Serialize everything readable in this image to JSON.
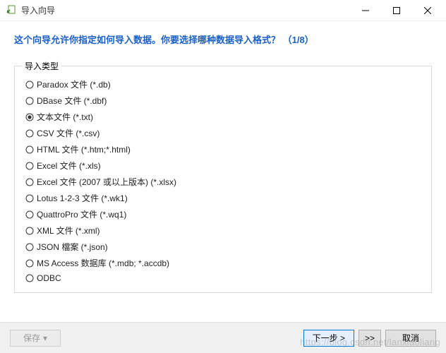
{
  "window": {
    "title": "导入向导"
  },
  "header": {
    "text": "这个向导允许你指定如何导入数据。你要选择哪种数据导入格式？ （1/8）"
  },
  "group": {
    "legend": "导入类型",
    "options": [
      {
        "label": "Paradox 文件 (*.db)",
        "selected": false
      },
      {
        "label": "DBase 文件 (*.dbf)",
        "selected": false
      },
      {
        "label": "文本文件 (*.txt)",
        "selected": true
      },
      {
        "label": "CSV 文件 (*.csv)",
        "selected": false
      },
      {
        "label": "HTML 文件 (*.htm;*.html)",
        "selected": false
      },
      {
        "label": "Excel 文件 (*.xls)",
        "selected": false
      },
      {
        "label": "Excel 文件 (2007 或以上版本) (*.xlsx)",
        "selected": false
      },
      {
        "label": "Lotus 1-2-3 文件 (*.wk1)",
        "selected": false
      },
      {
        "label": "QuattroPro 文件 (*.wq1)",
        "selected": false
      },
      {
        "label": "XML 文件 (*.xml)",
        "selected": false
      },
      {
        "label": "JSON 檔案 (*.json)",
        "selected": false
      },
      {
        "label": "MS Access 数据库 (*.mdb; *.accdb)",
        "selected": false
      },
      {
        "label": "ODBC",
        "selected": false
      }
    ]
  },
  "buttons": {
    "save": "保存",
    "next": "下一步 >",
    "fast_forward": ">>",
    "cancel": "取消"
  },
  "watermark": "https://blog.csdn.net/lanxiaoliang"
}
